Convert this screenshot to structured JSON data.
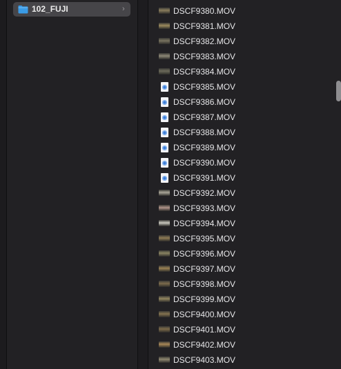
{
  "sidebar": {
    "folder": {
      "label": "102_FUJI",
      "icon": "folder-icon",
      "chevron": "chevron-right-icon",
      "color": "#3a9be6"
    }
  },
  "files": [
    {
      "name": "DSCF9380.MOV",
      "kind": "video",
      "thumb": "#8a7d5c"
    },
    {
      "name": "DSCF9381.MOV",
      "kind": "video",
      "thumb": "#9b8a5d"
    },
    {
      "name": "DSCF9382.MOV",
      "kind": "video",
      "thumb": "#78735f"
    },
    {
      "name": "DSCF9383.MOV",
      "kind": "video",
      "thumb": "#8d8876"
    },
    {
      "name": "DSCF9384.MOV",
      "kind": "video",
      "thumb": "#6c6a5a"
    },
    {
      "name": "DSCF9385.MOV",
      "kind": "generic",
      "thumb": ""
    },
    {
      "name": "DSCF9386.MOV",
      "kind": "generic",
      "thumb": ""
    },
    {
      "name": "DSCF9387.MOV",
      "kind": "generic",
      "thumb": ""
    },
    {
      "name": "DSCF9388.MOV",
      "kind": "generic",
      "thumb": ""
    },
    {
      "name": "DSCF9389.MOV",
      "kind": "generic",
      "thumb": ""
    },
    {
      "name": "DSCF9390.MOV",
      "kind": "generic",
      "thumb": ""
    },
    {
      "name": "DSCF9391.MOV",
      "kind": "generic",
      "thumb": ""
    },
    {
      "name": "DSCF9392.MOV",
      "kind": "video",
      "thumb": "#a9a598"
    },
    {
      "name": "DSCF9393.MOV",
      "kind": "video",
      "thumb": "#b0948a"
    },
    {
      "name": "DSCF9394.MOV",
      "kind": "video",
      "thumb": "#c9c8bf"
    },
    {
      "name": "DSCF9395.MOV",
      "kind": "video",
      "thumb": "#8e7b55"
    },
    {
      "name": "DSCF9396.MOV",
      "kind": "video",
      "thumb": "#8a8462"
    },
    {
      "name": "DSCF9397.MOV",
      "kind": "video",
      "thumb": "#9b8254"
    },
    {
      "name": "DSCF9398.MOV",
      "kind": "video",
      "thumb": "#7c6b4c"
    },
    {
      "name": "DSCF9399.MOV",
      "kind": "video",
      "thumb": "#938760"
    },
    {
      "name": "DSCF9400.MOV",
      "kind": "video",
      "thumb": "#84734f"
    },
    {
      "name": "DSCF9401.MOV",
      "kind": "video",
      "thumb": "#7d6b4a"
    },
    {
      "name": "DSCF9402.MOV",
      "kind": "video",
      "thumb": "#a88756"
    },
    {
      "name": "DSCF9403.MOV",
      "kind": "video",
      "thumb": "#8f8871"
    }
  ]
}
